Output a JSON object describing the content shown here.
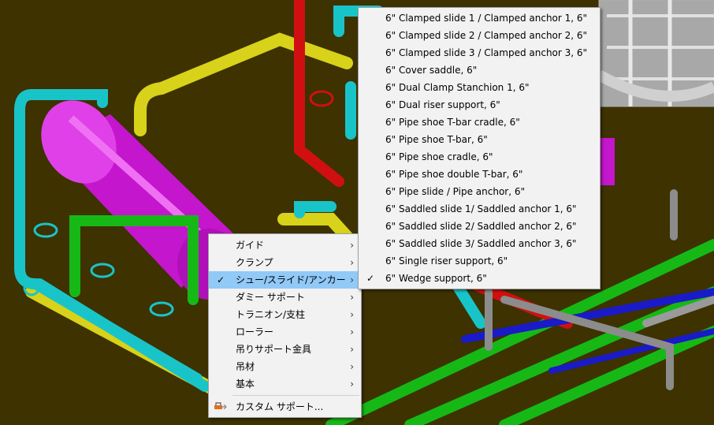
{
  "context_menu": {
    "items": [
      {
        "label": "ガイド",
        "has_submenu": true,
        "checked": false,
        "highlighted": false
      },
      {
        "label": "クランプ",
        "has_submenu": true,
        "checked": false,
        "highlighted": false
      },
      {
        "label": "シュー/スライド/アンカー",
        "has_submenu": true,
        "checked": true,
        "highlighted": true
      },
      {
        "label": "ダミー サポート",
        "has_submenu": true,
        "checked": false,
        "highlighted": false
      },
      {
        "label": "トラニオン/支柱",
        "has_submenu": true,
        "checked": false,
        "highlighted": false
      },
      {
        "label": "ローラー",
        "has_submenu": true,
        "checked": false,
        "highlighted": false
      },
      {
        "label": "吊りサポート金具",
        "has_submenu": true,
        "checked": false,
        "highlighted": false
      },
      {
        "label": "吊材",
        "has_submenu": true,
        "checked": false,
        "highlighted": false
      },
      {
        "label": "基本",
        "has_submenu": true,
        "checked": false,
        "highlighted": false
      }
    ],
    "custom_item": {
      "label": "カスタム サポート...",
      "icon": "custom-support-icon"
    },
    "check_glyph": "✓",
    "arrow_glyph": "›"
  },
  "submenu": {
    "items": [
      {
        "label": "6\" Clamped slide 1 / Clamped anchor 1, 6\"",
        "checked": false
      },
      {
        "label": "6\" Clamped slide 2 / Clamped anchor 2, 6\"",
        "checked": false
      },
      {
        "label": "6\" Clamped slide 3 / Clamped anchor 3, 6\"",
        "checked": false
      },
      {
        "label": "6\" Cover saddle, 6\"",
        "checked": false
      },
      {
        "label": "6\" Dual Clamp Stanchion 1, 6\"",
        "checked": false
      },
      {
        "label": "6\" Dual riser support, 6\"",
        "checked": false
      },
      {
        "label": "6\" Pipe shoe T-bar cradle, 6\"",
        "checked": false
      },
      {
        "label": "6\" Pipe shoe T-bar, 6\"",
        "checked": false
      },
      {
        "label": "6\" Pipe shoe cradle, 6\"",
        "checked": false
      },
      {
        "label": "6\" Pipe shoe double T-bar, 6\"",
        "checked": false
      },
      {
        "label": "6\" Pipe slide / Pipe anchor, 6\"",
        "checked": false
      },
      {
        "label": "6\" Saddled slide 1/ Saddled anchor 1, 6\"",
        "checked": false
      },
      {
        "label": "6\" Saddled slide 2/ Saddled anchor 2, 6\"",
        "checked": false
      },
      {
        "label": "6\" Saddled slide 3/ Saddled anchor 3, 6\"",
        "checked": false
      },
      {
        "label": "6\" Single riser support, 6\"",
        "checked": false
      },
      {
        "label": "6\" Wedge support, 6\"",
        "checked": true
      }
    ]
  },
  "colors": {
    "viewport_bg": "#3d3200",
    "pipe_cyan": "#19c4c8",
    "pipe_yellow": "#d8d21a",
    "vessel_magenta": "#d81ce0",
    "pipe_green": "#16b816",
    "pipe_red": "#d01010",
    "pipe_blue": "#1a1ac8",
    "pipe_gray": "#8c8c8c",
    "menu_bg": "#f2f2f2",
    "menu_highlight": "#91c9f7"
  }
}
